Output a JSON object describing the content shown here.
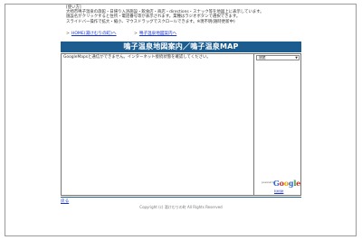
{
  "howto": {
    "title": "[使い方]",
    "lines": [
      "大崎市鳴子温泉の旅館・日帰り入浴施設・飲食店・商店・directions・スナック等を地図上に表示しています。",
      "施設名がクリックすると住所・電話番号等が表示されます。業種はラジオボタンで選択できます。",
      "スライドバー操作で拡大・縮小、マウスドラッグでスクロールできます。※現不明(随時更新中)"
    ]
  },
  "links": [
    {
      "arrow": ">",
      "text": "HOME(湯けむりの町)へ"
    },
    {
      "arrow": ">",
      "text": "鳴子温泉地図案内へ"
    }
  ],
  "title": "鳴子温泉地図案内／鳴子温泉MAP",
  "map": {
    "message": "GoogleMapsと通信ができません。インターネット接続状態を確認してください。"
  },
  "side_panel": {
    "select_value": "旅館",
    "powered_by": "powered by",
    "google": [
      "G",
      "o",
      "o",
      "g",
      "l",
      "e"
    ],
    "sub_link": "利用規約"
  },
  "footer": {
    "back": "戻る",
    "copyright": "Copyright (c) 湯けむりの町 All Rights Reserved"
  },
  "colors": {
    "title_bar": "#1d5c8f",
    "link": "#1a33c8"
  }
}
